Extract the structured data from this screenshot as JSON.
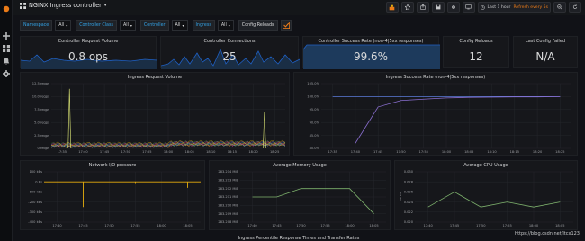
{
  "dashboard": {
    "title": "NGINX Ingress controller",
    "title_caret": "▾"
  },
  "toolbar": {
    "time_range": "Last 1 hour",
    "refresh": "Refresh every 5s"
  },
  "variables": [
    {
      "label": "Namespace",
      "value": "All"
    },
    {
      "label": "Controller Class",
      "value": "All"
    },
    {
      "label": "Controller",
      "value": "All"
    },
    {
      "label": "Ingress",
      "value": "All"
    }
  ],
  "config_reloads_toggle": "Config Reloads",
  "stats": {
    "request_volume": {
      "title": "Controller Request Volume",
      "value": "0.8 ops"
    },
    "connections": {
      "title": "Controller Connections",
      "value": "25"
    },
    "success_rate": {
      "title": "Controller Success Rate (non-4|5xx responses)",
      "value": "99.6%"
    },
    "config_reloads": {
      "title": "Config Reloads",
      "value": "12"
    },
    "last_config_failed": {
      "title": "Last Config Failed",
      "value": "N/A"
    }
  },
  "graphs": {
    "ingress_request_volume": {
      "title": "Ingress Request Volume"
    },
    "ingress_success_rate": {
      "title": "Ingress Success Rate (non-4|5xx responses)"
    },
    "network_io": {
      "title": "Network I/O pressure"
    },
    "memory": {
      "title": "Average Memory Usage"
    },
    "cpu": {
      "title": "Average CPU Usage"
    }
  },
  "bottom": {
    "title": "Ingress Percentile Response Times and Transfer Rates"
  },
  "watermark": "https://blog.csdn.net/ltcx123",
  "colors": {
    "accent": "#33a2e5",
    "green": "#7eb26d",
    "yellow": "#e5ac0e",
    "purple": "#6d5fd5",
    "orange": "#eb7b18",
    "blue_fill": "#1f60c4"
  },
  "chart_data": [
    {
      "type": "line",
      "title": "Ingress Request Volume",
      "x": [
        "17:35",
        "17:40",
        "17:45",
        "17:50",
        "17:55",
        "18:00",
        "18:05",
        "18:10",
        "18:15",
        "18:20",
        "18:25"
      ],
      "y_ticks": [
        "0 reqps",
        "2.5 reqps",
        "5.0 reqps",
        "7.5 reqps",
        "10.0 reqps",
        "12.5 reqps"
      ],
      "ylim": [
        0,
        12.5
      ],
      "series": [
        {
          "values": [
            0.2,
            0.3,
            0.4,
            0.3,
            0.5,
            0.6,
            0.8,
            0.7,
            0.9,
            0.6,
            0.8
          ],
          "peaks": [
            [
              17.42,
              11.5
            ],
            [
              18.17,
              7.0
            ]
          ]
        }
      ]
    },
    {
      "type": "line",
      "title": "Ingress Success Rate (non-4|5xx responses)",
      "x": [
        "17:35",
        "17:40",
        "17:45",
        "17:50",
        "17:55",
        "18:00",
        "18:05",
        "18:10",
        "18:15",
        "18:20",
        "18:25"
      ],
      "y_ticks": [
        "80.0%",
        "85.0%",
        "90.0%",
        "95.0%",
        "100.0%",
        "105.0%"
      ],
      "ylim": [
        80,
        105
      ],
      "series": [
        {
          "values": [
            100,
            100,
            100,
            100,
            100,
            100,
            100,
            100,
            100,
            100,
            100
          ]
        },
        {
          "values": [
            null,
            82,
            96,
            98.5,
            99,
            99.5,
            99.7,
            99.8,
            99.9,
            99.9,
            100
          ]
        }
      ]
    },
    {
      "type": "line",
      "title": "Network I/O pressure",
      "x": [
        "17:40",
        "17:45",
        "17:50",
        "17:55",
        "18:00",
        "18:05"
      ],
      "y_ticks": [
        "-400 kBs",
        "-300 kBs",
        "-200 kBs",
        "-100 kBs",
        "0 Bs",
        "100 kBs"
      ],
      "ylim": [
        -400,
        100
      ],
      "series": [
        {
          "values": [
            0,
            -250,
            0,
            -20,
            0,
            -60
          ]
        }
      ]
    },
    {
      "type": "line",
      "title": "Average Memory Usage",
      "x": [
        "17:40",
        "17:45",
        "17:50",
        "17:55",
        "18:00",
        "18:05"
      ],
      "y_ticks": [
        "283.208 MiB",
        "283.209 MiB",
        "283.210 MiB",
        "283.211 MiB",
        "283.212 MiB",
        "283.213 MiB",
        "283.214 MiB"
      ],
      "ylim": [
        283.208,
        283.214
      ],
      "series": [
        {
          "values": [
            283.211,
            283.211,
            283.212,
            283.212,
            283.212,
            283.209
          ]
        }
      ]
    },
    {
      "type": "line",
      "title": "Average CPU Usage",
      "x": [
        "17:40",
        "17:45",
        "17:50",
        "17:55",
        "18:00",
        "18:05"
      ],
      "y_ticks": [
        "0.020",
        "0.022",
        "0.024",
        "0.026",
        "0.028",
        "0.030"
      ],
      "ylabel": "cores",
      "ylim": [
        0.02,
        0.03
      ],
      "series": [
        {
          "values": [
            0.023,
            0.026,
            0.023,
            0.024,
            0.023,
            0.024
          ]
        }
      ]
    }
  ]
}
